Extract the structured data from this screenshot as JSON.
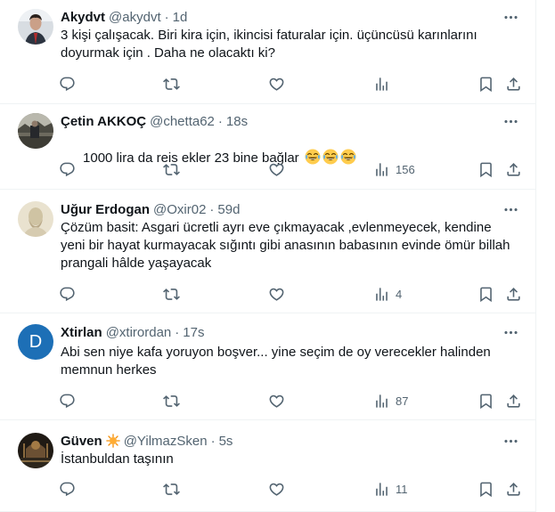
{
  "tweets": [
    {
      "name": "Akydvt",
      "handle": "@akydvt",
      "time": "1d",
      "text": "3 kişi çalışacak. Biri kira için, ikincisi faturalar için. üçüncüsü karınlarını\ndoyurmak için . Daha ne olacaktı ki?",
      "views": ""
    },
    {
      "name": "Çetin AKKOÇ",
      "handle": "@chetta62",
      "time": "18s",
      "text": "1000 lira da reis ekler 23 bine bağlar ",
      "views": "156"
    },
    {
      "name": "Uğur Erdogan",
      "handle": "@Oxir02",
      "time": "59d",
      "text": "Çözüm basit: Asgari ücretli ayrı eve çıkmayacak ,evlenmeyecek, kendine\nyeni bir hayat kurmayacak sığıntı gibi anasının babasının evinde ömür billah\nprangali hâlde yaşayacak",
      "views": "4"
    },
    {
      "name": "Xtirlan",
      "handle": "@xtirordan",
      "time": "17s",
      "avatar_letter": "D",
      "text": "Abi sen niye kafa yoruyon boşver... yine seçim de oy verecekler halinden\nmemnun herkes",
      "views": "87"
    },
    {
      "name": "Güven",
      "handle": "@YilmazSken",
      "time": "5s",
      "text": "İstanbuldan taşının",
      "views": "11"
    }
  ],
  "separator": "·",
  "colors": {
    "text": "#0f1419",
    "muted": "#536471",
    "divider": "#eff3f4",
    "avatar_letter_bg": "#1d6fb6"
  }
}
